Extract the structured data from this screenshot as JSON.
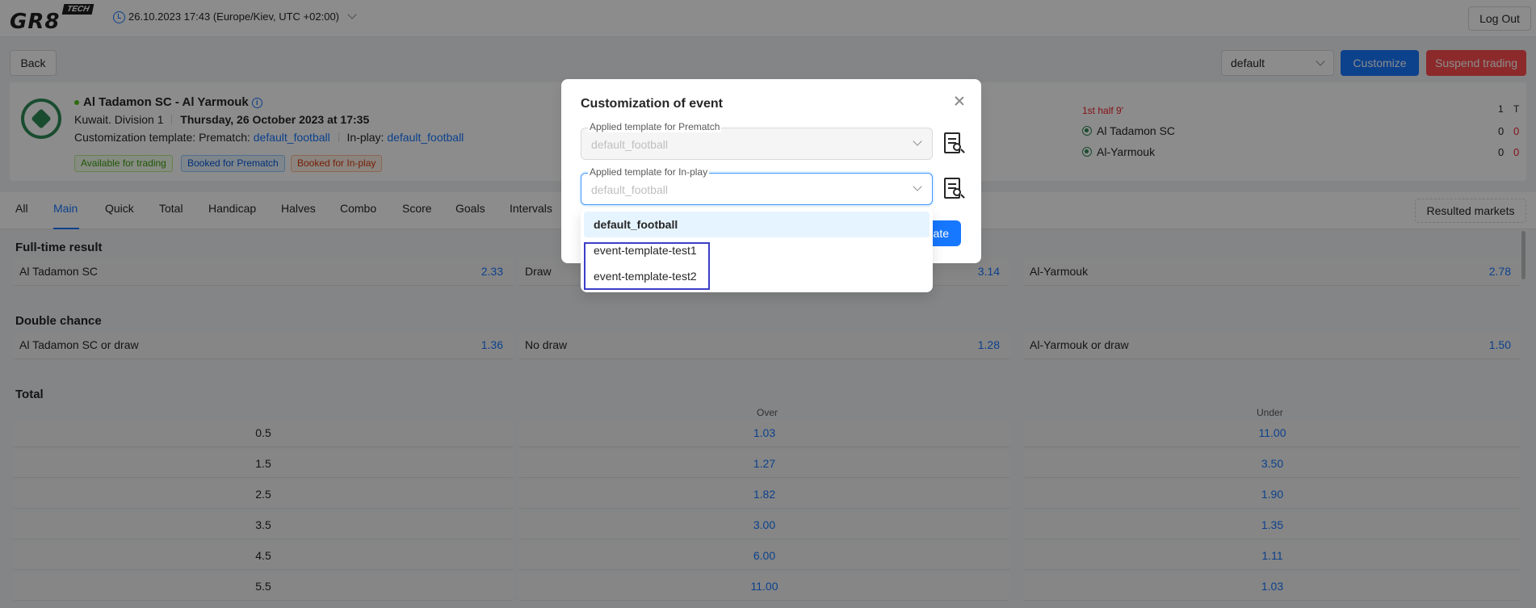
{
  "header": {
    "logo": "GR8",
    "logo_badge": "TECH",
    "datetime": "26.10.2023 17:43 (Europe/Kiev, UTC +02:00)",
    "logout_label": "Log Out"
  },
  "toolbar": {
    "back_label": "Back",
    "profile_value": "default",
    "customize_label": "Customize",
    "suspend_label": "Suspend trading"
  },
  "event": {
    "title": "Al Tadamon SC - Al Yarmouk",
    "league": "Kuwait. Division 1",
    "date": "Thursday, 26 October 2023 at 17:35",
    "template_prefix": "Customization template: Prematch:",
    "prematch_template": "default_football",
    "inplay_prefix": "In-play:",
    "inplay_template": "default_football",
    "tags": [
      "Available for trading",
      "Booked for Prematch",
      "Booked for In-play"
    ],
    "period": "1st half 9'",
    "score_cols": [
      "1",
      "T"
    ],
    "teams": [
      {
        "name": "Al Tadamon SC",
        "s1": "0",
        "total": "0"
      },
      {
        "name": "Al-Yarmouk",
        "s1": "0",
        "total": "0"
      }
    ]
  },
  "tabs": [
    "All",
    "Main",
    "Quick",
    "Total",
    "Handicap",
    "Halves",
    "Combo",
    "Score",
    "Goals",
    "Intervals"
  ],
  "resulted_label": "Resulted markets",
  "markets": {
    "fulltime": {
      "title": "Full-time result",
      "cells": [
        {
          "label": "Al Tadamon SC",
          "odds": "2.33"
        },
        {
          "label": "Draw",
          "odds": "3.14"
        },
        {
          "label": "Al-Yarmouk",
          "odds": "2.78"
        }
      ]
    },
    "double": {
      "title": "Double chance",
      "cells": [
        {
          "label": "Al Tadamon SC or draw",
          "odds": "1.36"
        },
        {
          "label": "No draw",
          "odds": "1.28"
        },
        {
          "label": "Al-Yarmouk or draw",
          "odds": "1.50"
        }
      ]
    },
    "total": {
      "title": "Total",
      "over_label": "Over",
      "under_label": "Under",
      "rows": [
        {
          "line": "0.5",
          "over": "1.03",
          "under": "11.00"
        },
        {
          "line": "1.5",
          "over": "1.27",
          "under": "3.50"
        },
        {
          "line": "2.5",
          "over": "1.82",
          "under": "1.90"
        },
        {
          "line": "3.5",
          "over": "3.00",
          "under": "1.35"
        },
        {
          "line": "4.5",
          "over": "6.00",
          "under": "1.11"
        },
        {
          "line": "5.5",
          "over": "11.00",
          "under": "1.03"
        }
      ]
    }
  },
  "modal": {
    "title": "Customization of event",
    "prematch_label": "Applied template for Prematch",
    "prematch_value": "default_football",
    "inplay_label": "Applied template for In-play",
    "inplay_placeholder": "default_football",
    "apply_label": "ate",
    "options": [
      "default_football",
      "event-template-test1",
      "event-template-test2"
    ]
  },
  "colors": {
    "primary": "#1677ff",
    "danger": "#ff4d4f",
    "highlight": "#3b3fc8"
  }
}
